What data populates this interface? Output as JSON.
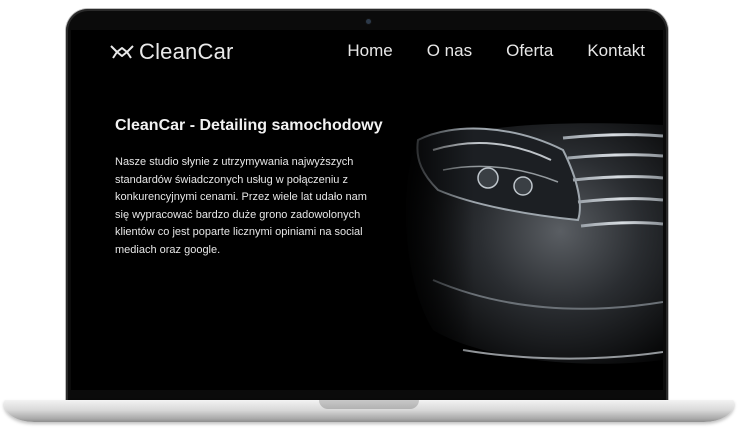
{
  "brand": {
    "name": "CleanCar"
  },
  "nav": {
    "items": [
      {
        "label": "Home"
      },
      {
        "label": "O nas"
      },
      {
        "label": "Oferta"
      },
      {
        "label": "Kontakt"
      }
    ]
  },
  "hero": {
    "title": "CleanCar - Detailing samochodowy",
    "text": "Nasze studio słynie z utrzymywania najwyższych standardów świadczonych usług w połączeniu z konkurencyjnymi cenami. Przez wiele lat udało nam się wypracować bardzo duże grono zadowolonych klientów co jest poparte licznymi opiniami na social mediach oraz google."
  },
  "colors": {
    "screen_bg": "#000000",
    "text": "#e9e9e9",
    "laptop_frame": "#0b0b0b",
    "laptop_base": "#d9d9d9"
  },
  "icons": {
    "logo": "car-wash-logo-icon",
    "camera": "webcam-dot"
  }
}
